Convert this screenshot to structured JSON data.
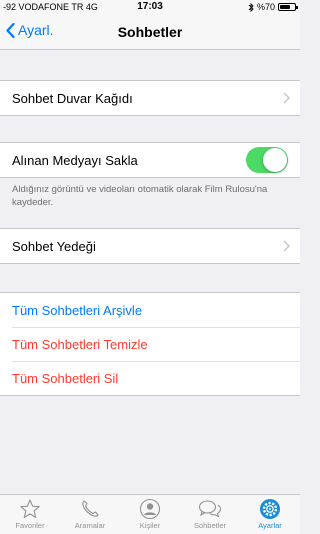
{
  "status_bar": {
    "carrier": "-92 VODAFONE TR  4G",
    "time": "17:03",
    "battery_text": "%70",
    "battery_level": 0.7
  },
  "nav": {
    "back_label": "Ayarl.",
    "title": "Sohbetler"
  },
  "groups": {
    "wallpaper": {
      "label": "Sohbet Duvar Kağıdı"
    },
    "save_media": {
      "label": "Alınan Medyayı Sakla",
      "toggle_on": true,
      "footnote": "Aldığınız görüntü ve videoları otomatik olarak Film Rulosu'na kaydeder."
    },
    "backup": {
      "label": "Sohbet Yedeği"
    },
    "actions": {
      "archive_all": "Tüm Sohbetleri Arşivle",
      "clear_all": "Tüm Sohbetleri Temizle",
      "delete_all": "Tüm Sohbetleri Sil"
    }
  },
  "colors": {
    "accent": "#007aff",
    "destructive": "#ff3b30",
    "toggle_on": "#4cd964",
    "tab_active": "#1a8dd6"
  },
  "tab_bar": {
    "items": [
      {
        "label": "Favoriler",
        "icon": "star-icon"
      },
      {
        "label": "Aramalar",
        "icon": "phone-icon"
      },
      {
        "label": "Kişiler",
        "icon": "contact-icon"
      },
      {
        "label": "Sohbetler",
        "icon": "chat-bubbles-icon"
      },
      {
        "label": "Ayarlar",
        "icon": "gear-icon",
        "active": true
      }
    ]
  }
}
